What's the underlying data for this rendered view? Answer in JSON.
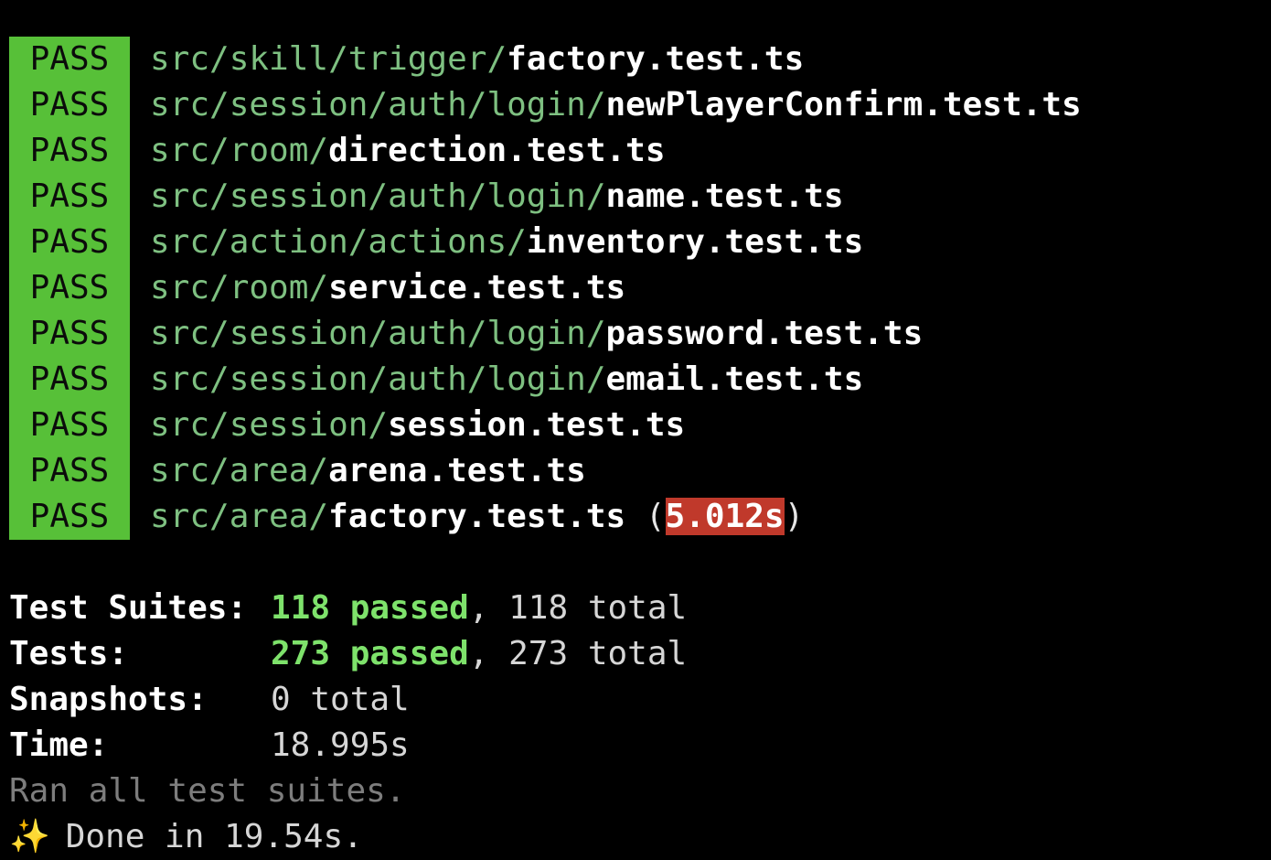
{
  "colors": {
    "pass_bg": "#57c038",
    "path": "#7ec081",
    "slow_bg": "#c0392b",
    "passed": "#7ee26b",
    "muted": "#7d7d7d"
  },
  "results": [
    {
      "badge": "PASS",
      "dir": "src/skill/trigger/",
      "file": "factory.test.ts"
    },
    {
      "badge": "PASS",
      "dir": "src/session/auth/login/",
      "file": "newPlayerConfirm.test.ts"
    },
    {
      "badge": "PASS",
      "dir": "src/room/",
      "file": "direction.test.ts"
    },
    {
      "badge": "PASS",
      "dir": "src/session/auth/login/",
      "file": "name.test.ts"
    },
    {
      "badge": "PASS",
      "dir": "src/action/actions/",
      "file": "inventory.test.ts"
    },
    {
      "badge": "PASS",
      "dir": "src/room/",
      "file": "service.test.ts"
    },
    {
      "badge": "PASS",
      "dir": "src/session/auth/login/",
      "file": "password.test.ts"
    },
    {
      "badge": "PASS",
      "dir": "src/session/auth/login/",
      "file": "email.test.ts"
    },
    {
      "badge": "PASS",
      "dir": "src/session/",
      "file": "session.test.ts"
    },
    {
      "badge": "PASS",
      "dir": "src/area/",
      "file": "arena.test.ts"
    },
    {
      "badge": "PASS",
      "dir": "src/area/",
      "file": "factory.test.ts",
      "duration": "5.012s"
    }
  ],
  "summary": {
    "suites": {
      "label": "Test Suites:",
      "passed": "118 passed",
      "sep": ",",
      "total": "118 total"
    },
    "tests": {
      "label": "Tests:",
      "passed": "273 passed",
      "sep": ",",
      "total": "273 total"
    },
    "snapshots": {
      "label": "Snapshots:",
      "value": "0 total"
    },
    "time": {
      "label": "Time:",
      "value": "18.995s"
    },
    "ran": "Ran all test suites.",
    "done_icon": "✨",
    "done": "Done in 19.54s."
  }
}
